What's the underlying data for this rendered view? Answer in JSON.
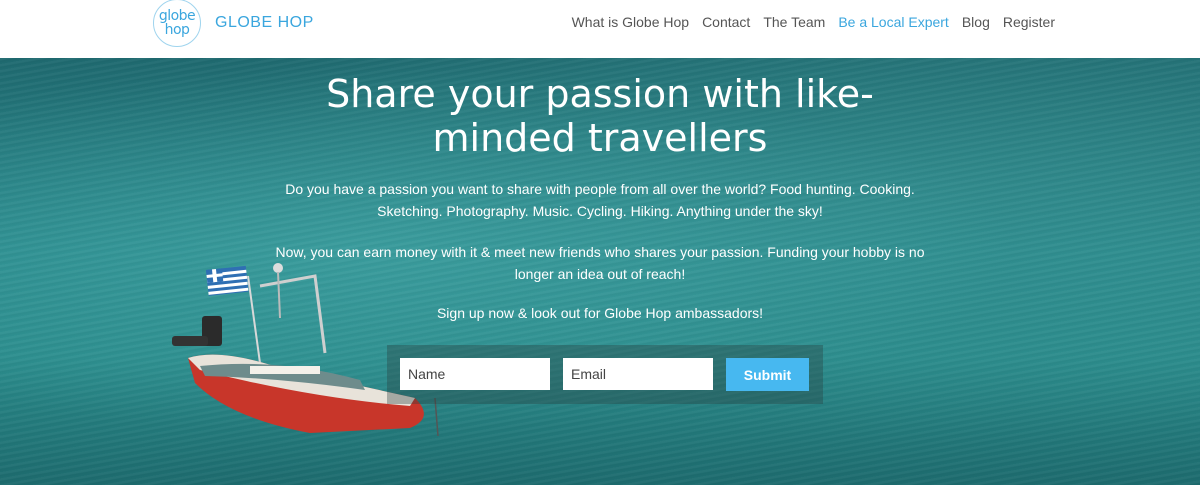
{
  "header": {
    "logo_top": "globe",
    "logo_bottom": "hop",
    "brand": "GLOBE HOP",
    "nav": [
      {
        "label": "What is Globe Hop",
        "active": false
      },
      {
        "label": "Contact",
        "active": false
      },
      {
        "label": "The Team",
        "active": false
      },
      {
        "label": "Be a Local Expert",
        "active": true
      },
      {
        "label": "Blog",
        "active": false
      },
      {
        "label": "Register",
        "active": false
      }
    ]
  },
  "hero": {
    "title": "Share your passion with like-minded travellers",
    "paragraph1": "Do you have a passion you want to share with people from all over the world? Food hunting. Cooking. Sketching. Photography. Music. Cycling. Hiking. Anything under the sky!",
    "paragraph2": "Now, you can earn money with it & meet new friends who shares your passion. Funding your hobby is no longer an idea out of reach!",
    "paragraph3": "Sign up now & look out for Globe Hop ambassadors!"
  },
  "form": {
    "name_placeholder": "Name",
    "email_placeholder": "Email",
    "submit_label": "Submit"
  },
  "colors": {
    "accent": "#3aa6de",
    "button": "#47b8f0",
    "sea": "#2a8a8c"
  }
}
